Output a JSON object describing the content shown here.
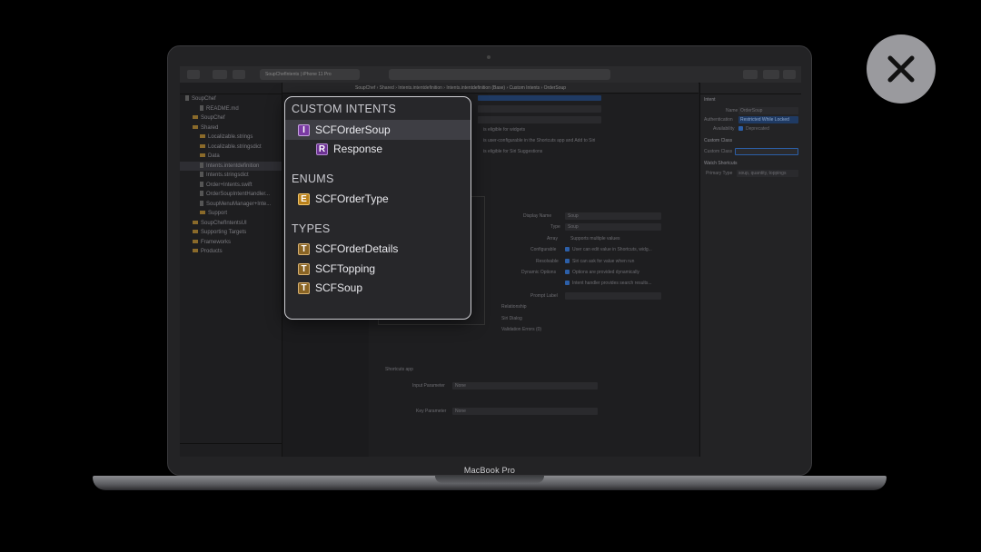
{
  "device_label": "MacBook Pro",
  "xcode": {
    "scheme": "SoupChefIntents  |  iPhone 11 Pro",
    "jumpbar": "SoupChef  ›  Shared  ›  Intents.intentdefinition  ›  Intents.intentdefinition (Base)  ›  Custom Intents  ›  OrderSoup",
    "navigator": [
      {
        "label": "SoupChef",
        "indent": 0,
        "kind": "file"
      },
      {
        "label": "README.md",
        "indent": 2,
        "kind": "file"
      },
      {
        "label": "SoupChef",
        "indent": 1,
        "kind": "folder"
      },
      {
        "label": "Shared",
        "indent": 1,
        "kind": "folder"
      },
      {
        "label": "Localizable.strings",
        "indent": 2,
        "kind": "folder"
      },
      {
        "label": "Localizable.stringsdict",
        "indent": 2,
        "kind": "folder"
      },
      {
        "label": "Data",
        "indent": 2,
        "kind": "folder"
      },
      {
        "label": "Intents.intentdefinition",
        "indent": 2,
        "kind": "file",
        "selected": true
      },
      {
        "label": "Intents.stringsdict",
        "indent": 2,
        "kind": "file"
      },
      {
        "label": "Order+Intents.swift",
        "indent": 2,
        "kind": "file"
      },
      {
        "label": "OrderSoupIntentHandler...",
        "indent": 2,
        "kind": "file"
      },
      {
        "label": "SoupMenuManager+Inte...",
        "indent": 2,
        "kind": "file"
      },
      {
        "label": "Support",
        "indent": 2,
        "kind": "folder"
      },
      {
        "label": "SoupChefIntentsUI",
        "indent": 1,
        "kind": "folder"
      },
      {
        "label": "Supporting Targets",
        "indent": 1,
        "kind": "folder"
      },
      {
        "label": "Frameworks",
        "indent": 1,
        "kind": "folder"
      },
      {
        "label": "Products",
        "indent": 1,
        "kind": "folder"
      }
    ],
    "editor": {
      "display_name_label": "Display Name",
      "display_name_value": "Soup",
      "type_label": "Type",
      "type_value": "Soup",
      "array_label": "Array",
      "array_value": "Supports multiple values",
      "configurable_label": "Configurable",
      "configurable_value": "User can edit value in Shortcuts, widg...",
      "resolvable_label": "Resolvable",
      "resolvable_value": "Siri can ask for value when run",
      "dynamic_label": "Dynamic Options",
      "dynamic_value": "Options are provided dynamically",
      "intent_handler_value": "Intent handler provides search results...",
      "prompt_label": "Prompt Label",
      "relationship": "Relationship",
      "siri_dialog": "Siri Dialog",
      "validation_errors": "Validation Errors (0)",
      "widgets": "is eligible for widgets",
      "configurable_intent": "is user-configurable in the Shortcuts app and Add to Siri",
      "siri_suggestions": "is eligible for Siri Suggestions",
      "shortcuts_app": "Shortcuts app",
      "input_parameter_label": "Input Parameter",
      "input_parameter_value": "None",
      "key_parameter_label": "Key Parameter",
      "key_parameter_value": "None"
    },
    "inspector": {
      "section": "Intent",
      "name_label": "Name",
      "name_value": "OrderSoup",
      "auth_label": "Authentication",
      "auth_value": "Restricted While Locked",
      "availability_label": "Availability",
      "availability_value": "Deprecated",
      "custom_class_title": "Custom Class",
      "custom_class_label": "Custom Class",
      "watch_title": "Watch Shortcuts",
      "primary_type_label": "Primary Type",
      "primary_type_value": "soup, quantity, toppings"
    }
  },
  "popover": {
    "sections": [
      {
        "title": "CUSTOM INTENTS",
        "items": [
          {
            "badge": "I",
            "label": "SCFOrderSoup",
            "selected": true
          },
          {
            "badge": "R",
            "label": "Response",
            "indented": true
          }
        ]
      },
      {
        "title": "ENUMS",
        "items": [
          {
            "badge": "E",
            "label": "SCFOrderType"
          }
        ]
      },
      {
        "title": "TYPES",
        "items": [
          {
            "badge": "T",
            "label": "SCFOrderDetails"
          },
          {
            "badge": "T",
            "label": "SCFTopping"
          },
          {
            "badge": "T",
            "label": "SCFSoup"
          }
        ]
      }
    ]
  },
  "close_icon": "close-icon"
}
